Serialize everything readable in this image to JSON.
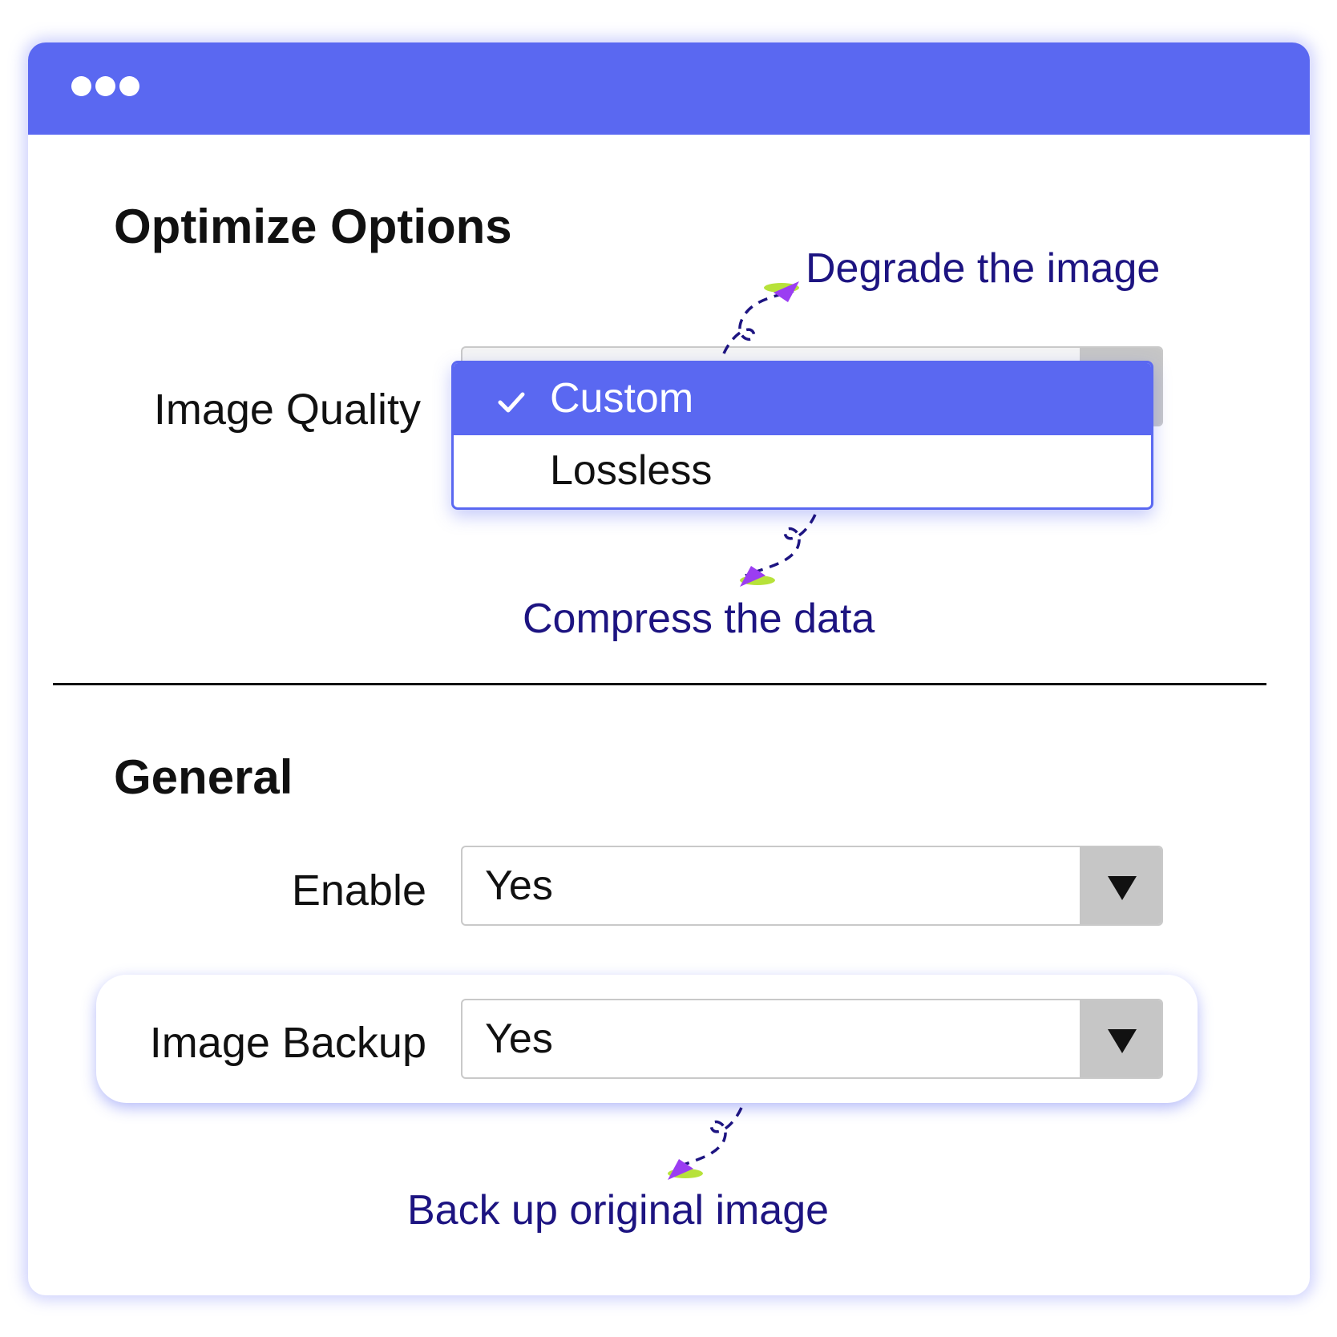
{
  "window": {
    "titlebar_icon": "three-dots-icon",
    "accent_color": "#5a68f1",
    "annotation_color": "#1d1481"
  },
  "optimize": {
    "title": "Optimize Options",
    "image_quality": {
      "label": "Image Quality",
      "options": [
        {
          "label": "Custom",
          "selected": true,
          "icon": "check-icon"
        },
        {
          "label": "Lossless",
          "selected": false
        }
      ]
    },
    "annotations": {
      "degrade": "Degrade the image",
      "compress": "Compress the data"
    }
  },
  "general": {
    "title": "General",
    "enable": {
      "label": "Enable",
      "value": "Yes",
      "icon": "triangle-down-icon"
    },
    "backup": {
      "label": "Image Backup",
      "value": "Yes",
      "icon": "triangle-down-icon"
    },
    "annotations": {
      "backup": "Back up original image"
    }
  }
}
